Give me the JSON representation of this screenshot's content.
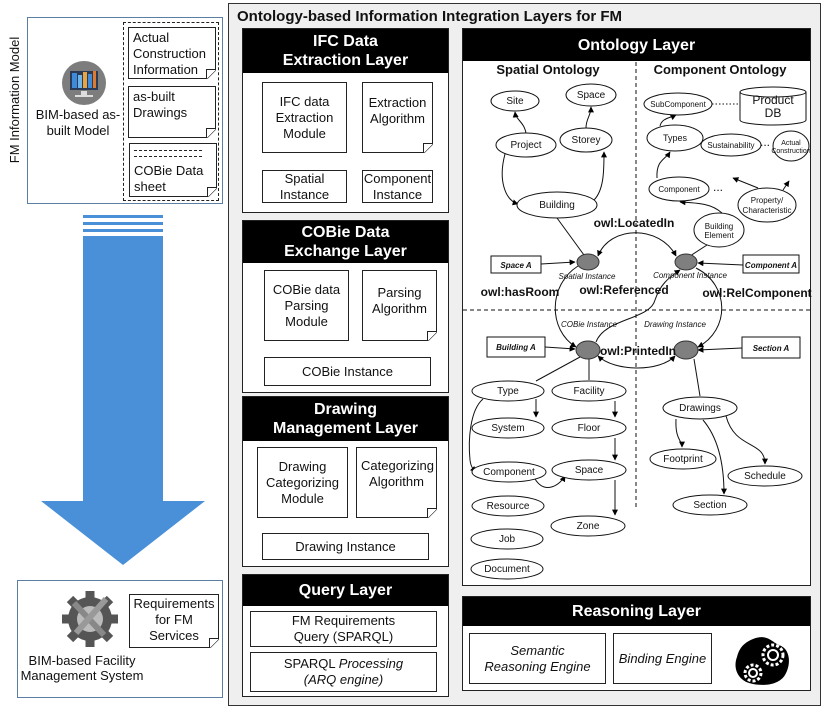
{
  "fm_model": {
    "side_label": "FM Information Model",
    "model_label": "BIM-based as-built Model",
    "notes": [
      "Actual Construction Information",
      "as-built Drawings",
      "COBie Data sheet"
    ],
    "cobie_note_dashes": "---------- ----------"
  },
  "fm_system": {
    "label": "BIM-based Facility Management System",
    "note": "Requirements for FM Services"
  },
  "main": {
    "title": "Ontology-based Information Integration Layers for FM",
    "ifc": {
      "title": "IFC Data Extraction Layer",
      "module": "IFC data Extraction Module",
      "algorithm": "Extraction Algorithm",
      "spatial": "Spatial Instance",
      "component": "Component Instance"
    },
    "cobie": {
      "title": "COBie Data Exchange Layer",
      "module": "COBie data Parsing Module",
      "algorithm": "Parsing Algorithm",
      "instance": "COBie Instance"
    },
    "drawing": {
      "title": "Drawing Management Layer",
      "module": "Drawing Categorizing Module",
      "algorithm": "Categorizing Algorithm",
      "instance": "Drawing Instance"
    },
    "query": {
      "title": "Query Layer",
      "box1": "FM Requirements Query (SPARQL)",
      "box2_plain": "SPARQL ",
      "box2_italic": "Processing",
      "box2_line2": "(ARQ engine)"
    },
    "reasoning": {
      "title": "Reasoning Layer",
      "semantic": "Semantic Reasoning Engine",
      "binding": "Binding Engine"
    }
  },
  "ontology": {
    "title": "Ontology Layer",
    "spatial_title": "Spatial Ontology",
    "component_title": "Component Ontology",
    "spatial_nodes": {
      "site": "Site",
      "space": "Space",
      "project": "Project",
      "storey": "Storey",
      "building": "Building"
    },
    "component_nodes": {
      "subcomponent": "SubComponent",
      "product_db_1": "Product",
      "product_db_2": "DB",
      "types": "Types",
      "sustainability": "Sustainability",
      "actual_1": "Actual",
      "actual_2": "Construction",
      "component": "Component",
      "property_1": "Property/",
      "property_2": "Characteristic",
      "building_element_1": "Building",
      "building_element_2": "Element",
      "ellipsis": "..."
    },
    "instances": {
      "spatial": "Spatial Instance",
      "component": "Component Instance",
      "cobie": "COBie Instance",
      "drawing": "Drawing Instance"
    },
    "examples": {
      "space_a": "Space A",
      "component_a": "Component A",
      "building_a": "Building A",
      "section_a": "Section A"
    },
    "relations": {
      "located_in": "owl:LocatedIn",
      "has_room": "owl:hasRoom",
      "referenced": "owl:Referenced",
      "rel_component": "owl:RelComponent",
      "printed_in": "owl:PrintedIn"
    },
    "cobie_nodes": {
      "type": "Type",
      "facility": "Facility",
      "system": "System",
      "floor": "Floor",
      "component": "Component",
      "space": "Space",
      "resource": "Resource",
      "zone": "Zone",
      "job": "Job",
      "document": "Document"
    },
    "drawing_nodes": {
      "drawings": "Drawings",
      "footprint": "Footprint",
      "schedule": "Schedule",
      "section": "Section"
    }
  },
  "colors": {
    "arrow": "#4a90d9",
    "panel_bg": "#efefef",
    "instance_fill": "#7f7f7f",
    "header": "#000000"
  }
}
